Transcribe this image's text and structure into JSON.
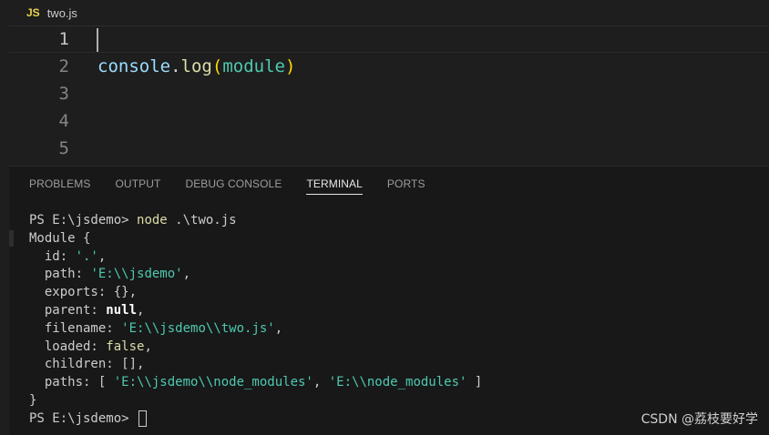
{
  "breadcrumb": {
    "badge": "JS",
    "filename": "two.js"
  },
  "editor": {
    "lines": [
      {
        "number": "1",
        "text": ""
      },
      {
        "number": "2",
        "tokens": [
          "console",
          ".",
          "log",
          "(",
          "module",
          ")"
        ]
      },
      {
        "number": "3",
        "text": ""
      },
      {
        "number": "4",
        "text": ""
      },
      {
        "number": "5",
        "text": ""
      }
    ]
  },
  "panel": {
    "tabs": [
      "PROBLEMS",
      "OUTPUT",
      "DEBUG CONSOLE",
      "TERMINAL",
      "PORTS"
    ],
    "active_tab": "TERMINAL"
  },
  "terminal": {
    "prompt1": "PS E:\\jsdemo> ",
    "command": "node",
    "command_arg": " .\\two.js",
    "l_module": "Module {",
    "l_id_key": "  id: ",
    "l_id_val": "'.'",
    "l_path_key": "  path: ",
    "l_path_val": "'E:\\\\jsdemo'",
    "l_exports": "  exports: {},",
    "l_parent_key": "  parent: ",
    "l_parent_val": "null",
    "l_filename_key": "  filename: ",
    "l_filename_val": "'E:\\\\jsdemo\\\\two.js'",
    "l_loaded_key": "  loaded: ",
    "l_loaded_val": "false",
    "l_children": "  children: [],",
    "l_paths_key": "  paths: [ ",
    "l_paths_val1": "'E:\\\\jsdemo\\\\node_modules'",
    "l_paths_sep": ", ",
    "l_paths_val2": "'E:\\\\node_modules'",
    "l_paths_end": " ]",
    "l_close": "}",
    "prompt2": "PS E:\\jsdemo> "
  },
  "watermark": "CSDN @荔枝要好学"
}
